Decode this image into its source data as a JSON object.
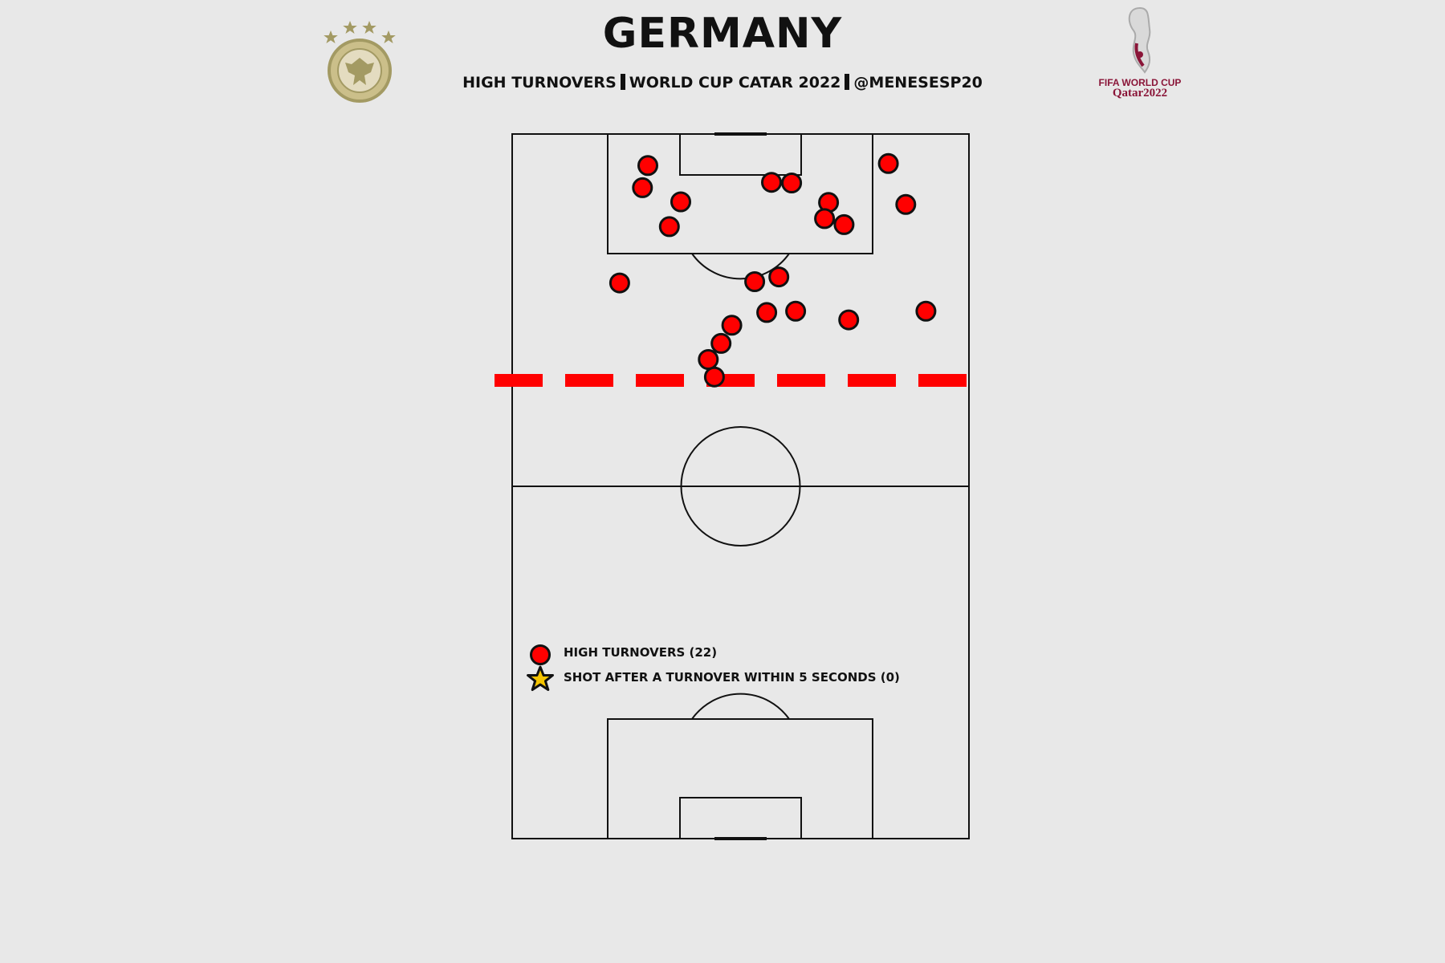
{
  "header": {
    "title": "GERMANY",
    "subtitle_parts": [
      "HIGH TURNOVERS",
      "WORLD CUP CATAR 2022",
      "@MENESESP20"
    ]
  },
  "logos": {
    "left": "dfb-crest",
    "right_line1": "FIFA WORLD CUP",
    "right_line2": "Qatar2022"
  },
  "colors": {
    "background": "#e8e8e8",
    "turnover_marker": "#ff0000",
    "line_threshold": "#ff0000",
    "shot_marker": "#f5c400"
  },
  "chart_data": {
    "type": "scatter",
    "pitch": "vertical half-pitch view, attacking upward, length 105, width 68",
    "threshold_line": "dashed red line at 40m from opponent goal",
    "series": [
      {
        "name": "HIGH TURNOVERS (22)",
        "marker": "circle",
        "points": [
          {
            "x": 20.2,
            "y": 4.7
          },
          {
            "x": 19.4,
            "y": 8.0
          },
          {
            "x": 25.1,
            "y": 10.1
          },
          {
            "x": 23.4,
            "y": 13.8
          },
          {
            "x": 38.6,
            "y": 7.2
          },
          {
            "x": 41.6,
            "y": 7.3
          },
          {
            "x": 47.1,
            "y": 10.2
          },
          {
            "x": 46.5,
            "y": 12.6
          },
          {
            "x": 49.4,
            "y": 13.5
          },
          {
            "x": 56.0,
            "y": 4.4
          },
          {
            "x": 58.6,
            "y": 10.5
          },
          {
            "x": 16.0,
            "y": 22.2
          },
          {
            "x": 36.1,
            "y": 22.0
          },
          {
            "x": 39.7,
            "y": 21.3
          },
          {
            "x": 32.7,
            "y": 28.5
          },
          {
            "x": 37.9,
            "y": 26.6
          },
          {
            "x": 42.2,
            "y": 26.4
          },
          {
            "x": 50.1,
            "y": 27.7
          },
          {
            "x": 61.6,
            "y": 26.4
          },
          {
            "x": 31.1,
            "y": 31.2
          },
          {
            "x": 29.2,
            "y": 33.6
          },
          {
            "x": 30.1,
            "y": 36.2
          }
        ]
      },
      {
        "name": "SHOT AFTER A TURNOVER WITHIN 5 SECONDS (0)",
        "marker": "star",
        "points": []
      }
    ],
    "legend": [
      {
        "label": "HIGH TURNOVERS (22)",
        "marker": "circle"
      },
      {
        "label": "SHOT AFTER A TURNOVER WITHIN 5 SECONDS (0)",
        "marker": "star"
      }
    ]
  }
}
